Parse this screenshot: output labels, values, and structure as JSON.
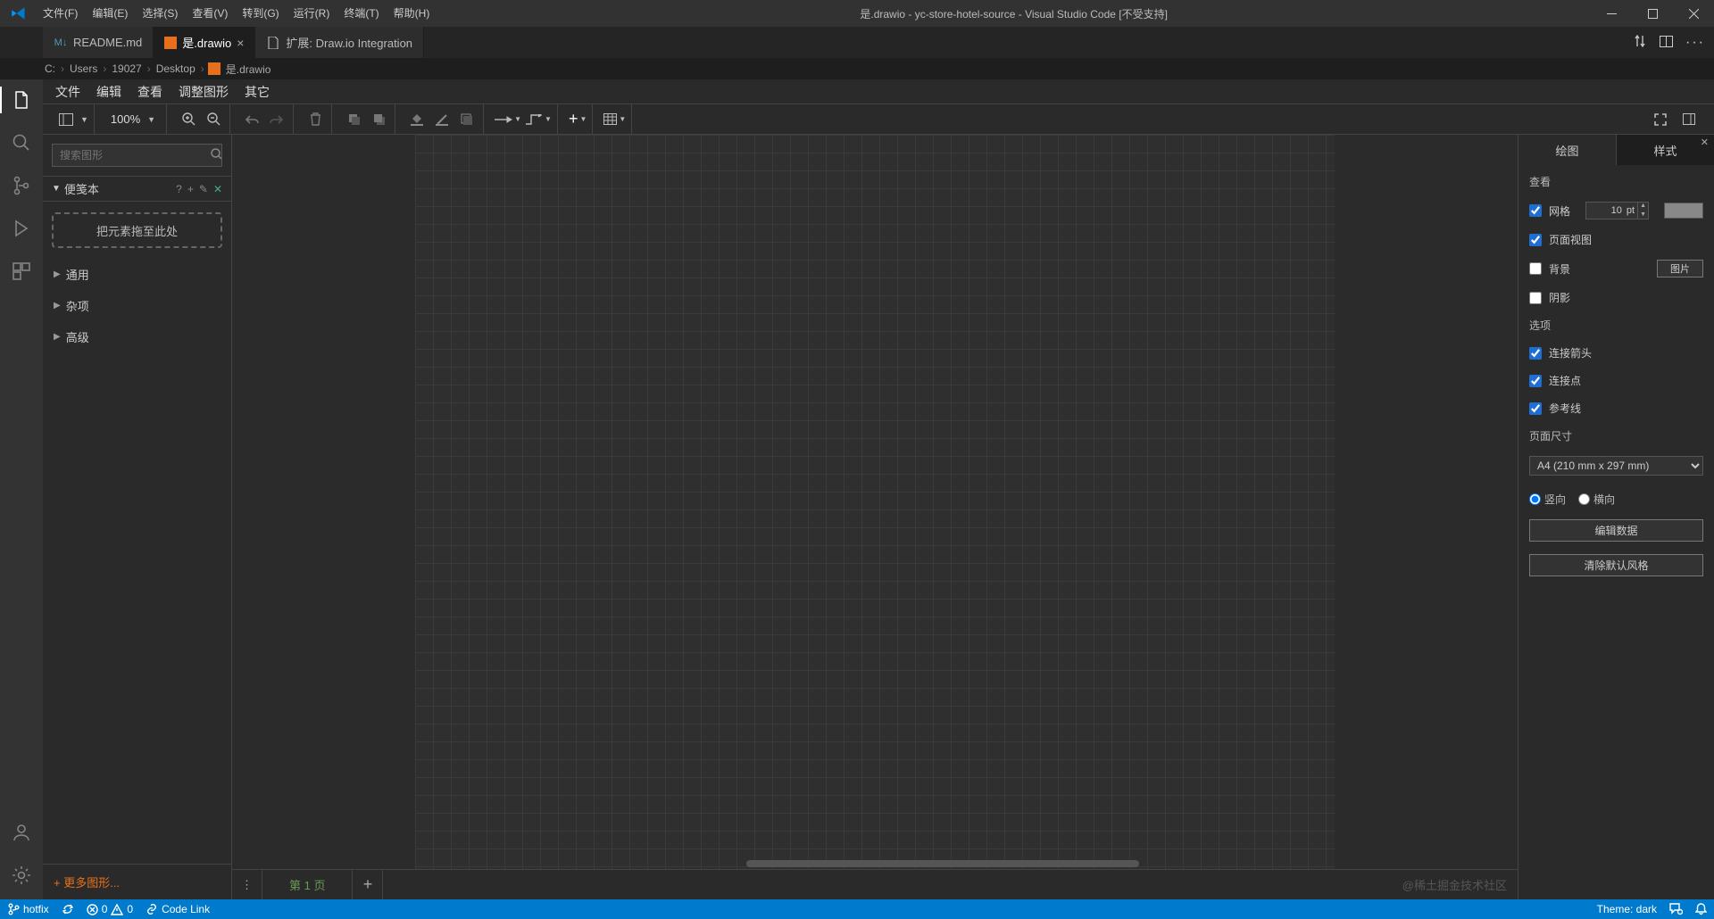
{
  "titlebar": {
    "menus": [
      "文件(F)",
      "编辑(E)",
      "选择(S)",
      "查看(V)",
      "转到(G)",
      "运行(R)",
      "终端(T)",
      "帮助(H)"
    ],
    "title": "是.drawio - yc-store-hotel-source - Visual Studio Code [不受支持]"
  },
  "tabs": [
    {
      "label": "README.md",
      "icon": "md",
      "active": false,
      "closable": false
    },
    {
      "label": "是.drawio",
      "icon": "drawio",
      "active": true,
      "closable": true
    },
    {
      "label": "扩展: Draw.io Integration",
      "icon": "doc",
      "active": false,
      "closable": false
    }
  ],
  "breadcrumb": [
    "C:",
    "Users",
    "19027",
    "Desktop",
    "是.drawio"
  ],
  "drawio": {
    "menus": [
      "文件",
      "编辑",
      "查看",
      "调整图形",
      "其它"
    ],
    "zoom": "100%",
    "search_placeholder": "搜索图形",
    "palette": {
      "scratch_title": "便笺本",
      "drop_hint": "把元素拖至此处",
      "sections": [
        "通用",
        "杂项",
        "高级"
      ],
      "more_shapes": "+ 更多图形..."
    },
    "page_tab": "第 1 页",
    "watermark": "@稀土掘金技术社区"
  },
  "format": {
    "tab_draw": "绘图",
    "tab_style": "样式",
    "section_view": "查看",
    "grid": "网格",
    "grid_value": "10",
    "grid_unit": "pt",
    "page_view": "页面视图",
    "background": "背景",
    "image_btn": "图片",
    "shadow": "阴影",
    "section_options": "选项",
    "connect_arrow": "连接箭头",
    "connect_point": "连接点",
    "guide": "参考线",
    "section_page": "页面尺寸",
    "paper": "A4 (210 mm x 297 mm)",
    "portrait": "竖向",
    "landscape": "横向",
    "edit_data": "编辑数据",
    "clear_style": "清除默认风格"
  },
  "status": {
    "branch": "hotfix",
    "errors": "0",
    "warnings": "0",
    "codelink": "Code Link",
    "theme": "Theme: dark"
  }
}
